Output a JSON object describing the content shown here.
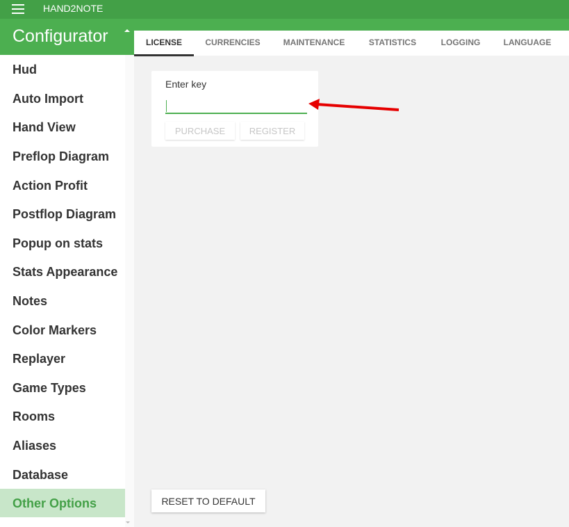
{
  "app": {
    "title": "HAND2NOTE",
    "menu_icon": "hamburger-menu-icon"
  },
  "section": {
    "title": "Configurator",
    "collapse_icon": "caret-up-icon"
  },
  "sidebar": {
    "items": [
      {
        "label": "Hud"
      },
      {
        "label": "Auto Import"
      },
      {
        "label": "Hand View"
      },
      {
        "label": "Preflop Diagram"
      },
      {
        "label": "Action Profit"
      },
      {
        "label": "Postflop Diagram"
      },
      {
        "label": "Popup on stats"
      },
      {
        "label": "Stats Appearance"
      },
      {
        "label": "Notes"
      },
      {
        "label": "Color Markers"
      },
      {
        "label": "Replayer"
      },
      {
        "label": "Game Types"
      },
      {
        "label": "Rooms"
      },
      {
        "label": "Aliases"
      },
      {
        "label": "Database"
      },
      {
        "label": "Other Options"
      }
    ],
    "active": "Other Options"
  },
  "tabs": [
    {
      "label": "LICENSE"
    },
    {
      "label": "CURRENCIES"
    },
    {
      "label": "MAINTENANCE"
    },
    {
      "label": "STATISTICS"
    },
    {
      "label": "LOGGING"
    },
    {
      "label": "LANGUAGE"
    }
  ],
  "active_tab": "LICENSE",
  "license": {
    "key_label": "Enter key",
    "key_value": "",
    "purchase_label": "PURCHASE",
    "register_label": "REGISTER"
  },
  "footer": {
    "reset_label": "RESET TO DEFAULT"
  },
  "colors": {
    "brand_green": "#43a047",
    "active_bg": "#c8e6c9",
    "annotation_arrow": "#e60000"
  }
}
